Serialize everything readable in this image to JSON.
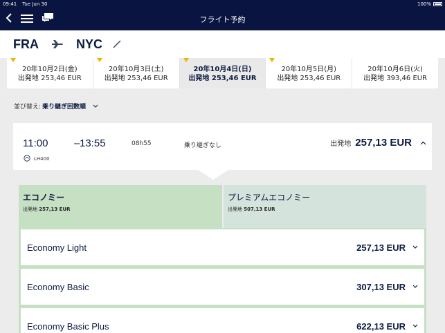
{
  "status_bar": {
    "time": "09:41",
    "date": "Tue Jun 30",
    "battery": "100%"
  },
  "nav": {
    "title": "フライト予約",
    "icons": [
      "back-icon",
      "menu-icon",
      "chat-icon"
    ]
  },
  "route": {
    "from": "FRA",
    "to": "NYC",
    "icons": [
      "plane-icon",
      "edit-icon"
    ]
  },
  "dates": [
    {
      "date": "20年10月2日(金)",
      "price": "出発地 253,46 EUR",
      "marker": true,
      "active": false
    },
    {
      "date": "20年10月3日(土)",
      "price": "出発地 253,46 EUR",
      "marker": true,
      "active": false
    },
    {
      "date": "20年10月4日(日)",
      "price": "出発地 253,46 EUR",
      "marker": true,
      "active": true
    },
    {
      "date": "20年10月5日(月)",
      "price": "出発地 253,46 EUR",
      "marker": true,
      "active": false
    },
    {
      "date": "20年10月6日(火)",
      "price": "出発地 393,46 EUR",
      "marker": false,
      "active": false
    }
  ],
  "sort": {
    "label": "並び替え:",
    "value": "乗り継ぎ回数順"
  },
  "flight": {
    "depart": "11:00",
    "dash": "–",
    "arrive": "13:55",
    "duration": "08h55",
    "stops": "乗り継ぎなし",
    "price_prefix": "出発地",
    "price": "257,13 EUR",
    "flight_number": "LH400"
  },
  "cabins": [
    {
      "name": "エコノミー",
      "price_prefix": "出発地",
      "price": "257,13 EUR",
      "selected": true
    },
    {
      "name": "プレミアムエコノミー",
      "price_prefix": "出発地",
      "price": "507,13 EUR",
      "selected": false
    }
  ],
  "fares": [
    {
      "name": "Economy Light",
      "price": "257,13 EUR"
    },
    {
      "name": "Economy Basic",
      "price": "307,13 EUR"
    },
    {
      "name": "Economy Basic Plus",
      "price": "622,13 EUR"
    }
  ],
  "colors": {
    "navy": "#0a1440",
    "marker": "#f0b400",
    "economy_green": "#c5e0c3",
    "premium_green": "#d4e3dc"
  }
}
